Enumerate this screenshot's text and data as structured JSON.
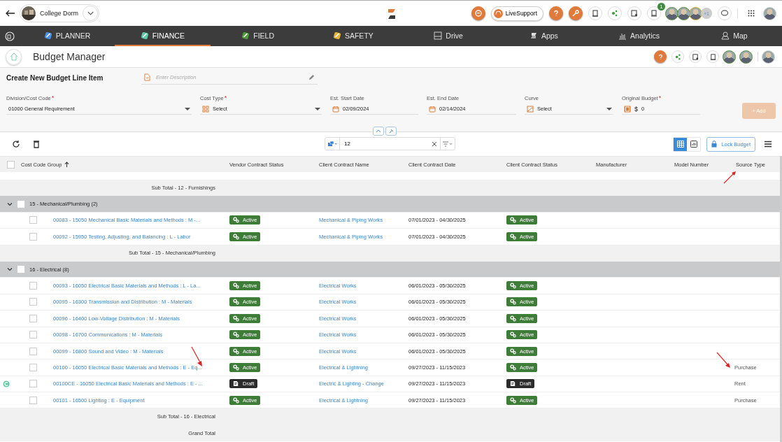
{
  "top_bar": {
    "project": "College Dorm",
    "support_label": "LiveSupport",
    "cart_count": "1",
    "extra_people": "+1"
  },
  "nav": [
    {
      "label": "PLANNER",
      "selected": false,
      "kind": "planner"
    },
    {
      "label": "FINANCE",
      "selected": true,
      "kind": "finance"
    },
    {
      "label": "FIELD",
      "selected": false,
      "kind": "field"
    },
    {
      "label": "SAFETY",
      "selected": false,
      "kind": "safety"
    },
    {
      "label": "Drive",
      "selected": false,
      "kind": "drive"
    },
    {
      "label": "Apps",
      "selected": false,
      "kind": "apps"
    },
    {
      "label": "Analytics",
      "selected": false,
      "kind": "analytics"
    },
    {
      "label": "Map",
      "selected": false,
      "kind": "map"
    }
  ],
  "page_title": "Budget Manager",
  "form": {
    "title": "Create New Budget Line Item",
    "description_placeholder": "Enter Description",
    "fields": [
      {
        "label": "Division/Cost Code",
        "required_mark": "*",
        "kind": "select",
        "value": "01000 General Requirement"
      },
      {
        "label": "Cost Type",
        "required_mark": "*",
        "kind": "select-grid",
        "value": "Select"
      },
      {
        "label": "Est. Start Date",
        "kind": "date",
        "value": "02/09/2024"
      },
      {
        "label": "Est. End Date",
        "kind": "date",
        "value": "02/14/2024"
      },
      {
        "label": "Curve",
        "kind": "select-curve",
        "value": "Select"
      },
      {
        "label": "Original Budget",
        "required_mark": "*",
        "kind": "money",
        "currency": "$",
        "value": "0"
      }
    ],
    "add_button": {
      "label": "+ Add",
      "disabled": true
    }
  },
  "toolbar": {
    "search_value": "12",
    "lock_label": "Lock Budget",
    "views": [
      {
        "kind": "grid",
        "selected": true
      },
      {
        "kind": "chart",
        "selected": false
      }
    ]
  },
  "table": {
    "all_checked": false,
    "columns": [
      {
        "label": "Cost Code Group",
        "sorted": true,
        "pointed": false
      },
      {
        "label": "Vendor Contract Status",
        "sorted": false,
        "pointed": false
      },
      {
        "label": "Client Contract Name",
        "sorted": false,
        "pointed": false
      },
      {
        "label": "Client Contract Date",
        "sorted": false,
        "pointed": false
      },
      {
        "label": "Client Contract Status",
        "sorted": false,
        "pointed": false
      },
      {
        "label": "Manufacturer",
        "sorted": false,
        "pointed": false
      },
      {
        "label": "Model Number",
        "sorted": false,
        "pointed": false
      },
      {
        "label": "Source Type",
        "sorted": false,
        "pointed": true
      }
    ],
    "rows": [
      {
        "kind": "subtotal",
        "label": "Sub Total - 12 - Furnishings"
      },
      {
        "kind": "group",
        "label": "15 - Mechanical/Plumbing",
        "count": "(2)",
        "expanded": true,
        "checked": false
      },
      {
        "kind": "item",
        "checked": false,
        "change_order": false,
        "name": "00083 - 15050 Mechanical Basic Materials and Methods : M -...",
        "vendor_status": "Active",
        "client_name": "Mechanical & Piping Works",
        "client_date": "07/01/2023 - 04/30/2025",
        "client_status": "Active",
        "pointed_name": false,
        "pointed_source": false
      },
      {
        "kind": "item",
        "checked": false,
        "change_order": false,
        "name": "00092 - 15950 Testing, Adjusting, and Balancing : L - Labor",
        "vendor_status": "Active",
        "client_name": "Mechanical & Piping Works",
        "client_date": "07/01/2023 - 04/30/2025",
        "client_status": "Active",
        "pointed_name": false,
        "pointed_source": false
      },
      {
        "kind": "subtotal",
        "label": "Sub Total - 15 - Mechanical/Plumbing"
      },
      {
        "kind": "group",
        "label": "16 - Electrical",
        "count": "(8)",
        "expanded": true,
        "checked": false
      },
      {
        "kind": "item",
        "checked": false,
        "change_order": false,
        "name": "00093 - 16050 Electrical Basic Materials and Methods : L - La...",
        "vendor_status": "Active",
        "client_name": "Electrical Works",
        "client_date": "06/01/2023 - 05/30/2025",
        "client_status": "Active",
        "pointed_name": false,
        "pointed_source": false
      },
      {
        "kind": "item",
        "checked": false,
        "change_order": false,
        "name": "00095 - 16300 Transmission and Distribution : M - Materials",
        "vendor_status": "Active",
        "client_name": "Electrical Works",
        "client_date": "06/01/2023 - 05/30/2025",
        "client_status": "Active",
        "pointed_name": false,
        "pointed_source": false
      },
      {
        "kind": "item",
        "checked": false,
        "change_order": false,
        "name": "00096 - 16400 Low-Voltage Distribution : M - Materials",
        "vendor_status": "Active",
        "client_name": "Electrical Works",
        "client_date": "06/01/2023 - 05/30/2025",
        "client_status": "Active",
        "pointed_name": false,
        "pointed_source": false
      },
      {
        "kind": "item",
        "checked": false,
        "change_order": false,
        "name": "00098 - 16700 Communications : M - Materials",
        "vendor_status": "Active",
        "client_name": "Electrical Works",
        "client_date": "06/01/2023 - 05/30/2025",
        "client_status": "Active",
        "pointed_name": false,
        "pointed_source": false
      },
      {
        "kind": "item",
        "checked": false,
        "change_order": false,
        "name": "00099 - 16800 Sound and Video : M - Materials",
        "vendor_status": "Active",
        "client_name": "Electrical Works",
        "client_date": "06/01/2023 - 05/30/2025",
        "client_status": "Active",
        "pointed_name": false,
        "pointed_source": false
      },
      {
        "kind": "item",
        "checked": false,
        "change_order": false,
        "name": "00100 - 16050 Electrical Basic Materials and Methods : E - Eq...",
        "vendor_status": "Active",
        "client_name": "Electrical & Lightning",
        "client_date": "09/27/2023 - 11/15/2023",
        "client_status": "Active",
        "source_type": "Purchase",
        "pointed_name": true,
        "pointed_source": true
      },
      {
        "kind": "item",
        "checked": false,
        "change_order": true,
        "name": "00100CE - 16050 Electrical Basic Materials and Methods : E - ...",
        "vendor_status": "Draft",
        "client_name": "Electric & Lighting - Change",
        "client_date": "09/27/2023 - 11/15/2023",
        "client_status": "Draft",
        "source_type": "Rent",
        "pointed_name": false,
        "pointed_source": false
      },
      {
        "kind": "item",
        "checked": false,
        "change_order": false,
        "name": "00101 - 16500 Lighting : E - Equipment",
        "vendor_status": "Active",
        "client_name": "Electrical & Lightning",
        "client_date": "09/27/2023 - 11/15/2023",
        "client_status": "Active",
        "source_type": "Purchase",
        "pointed_name": false,
        "pointed_source": false
      },
      {
        "kind": "subtotal",
        "label": "Sub Total - 16 - Electrical"
      },
      {
        "kind": "grandtotal",
        "label": "Grand Total"
      }
    ]
  }
}
